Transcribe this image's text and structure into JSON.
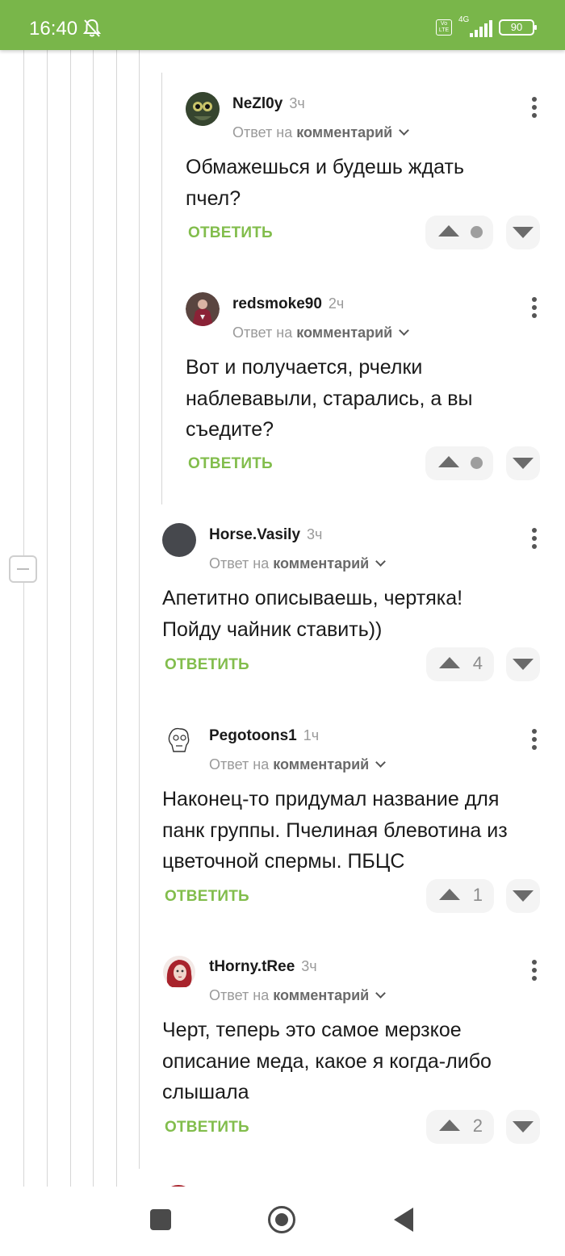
{
  "status_bar": {
    "time": "16:40",
    "network": "4G",
    "battery": "90",
    "volte": "Vo LTE"
  },
  "reply_label": "ОТВЕТИТЬ",
  "reply_to_prefix": "Ответ на",
  "reply_to_link": "комментарий",
  "comments": [
    {
      "author": "NeZl0y",
      "time": "3ч",
      "text_lines": [
        "Обмажешься и будешь ждать",
        "пчел?"
      ],
      "score": ""
    },
    {
      "author": "redsmoke90",
      "time": "2ч",
      "text_lines": [
        "Вот и получается, рчелки",
        "наблевавыли, старались, а вы",
        "съедите?"
      ],
      "score": ""
    },
    {
      "author": "Horse.Vasily",
      "time": "3ч",
      "text_lines": [
        "Апетитно описываешь, чертяка!",
        "Пойду чайник ставить))"
      ],
      "score": "4"
    },
    {
      "author": "Pegotoons1",
      "time": "1ч",
      "text_lines": [
        "Наконец-то придумал название для",
        "панк группы. Пчелиная блевотина из",
        "цветочной спермы. ПБЦС"
      ],
      "score": "1"
    },
    {
      "author": "tHorny.tRee",
      "time": "3ч",
      "text_lines": [
        "Черт, теперь это самое мерзкое",
        "описание меда, какое я когда-либо",
        "слышала"
      ],
      "score": "2"
    }
  ],
  "colors": {
    "statusbar": "#79b64a",
    "accent": "#82bd4c"
  },
  "icons": {
    "status": [
      "bell-off-icon",
      "volte-icon",
      "signal-icon",
      "battery-icon"
    ],
    "nav": [
      "recents-icon",
      "home-icon",
      "back-icon"
    ]
  }
}
